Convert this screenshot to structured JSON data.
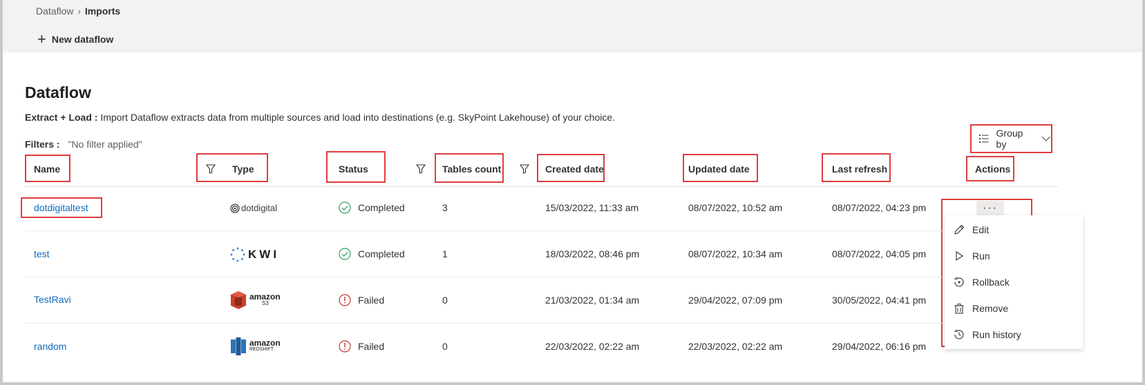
{
  "breadcrumb": {
    "root": "Dataflow",
    "current": "Imports"
  },
  "toolbar": {
    "new_label": "New dataflow"
  },
  "page": {
    "title": "Dataflow",
    "desc_bold": "Extract + Load :",
    "desc_text": "Import Dataflow extracts data from multiple sources and load into destinations (e.g. SkyPoint Lakehouse) of your choice.",
    "filters_label": "Filters :",
    "filters_value": "\"No filter applied\""
  },
  "groupby": {
    "label": "Group by"
  },
  "columns": {
    "name": "Name",
    "type": "Type",
    "status": "Status",
    "tables_count": "Tables count",
    "created_date": "Created date",
    "updated_date": "Updated date",
    "last_refresh": "Last refresh",
    "actions": "Actions"
  },
  "rows": [
    {
      "name": "dotdigitaltest",
      "type_logo": "dotdigital",
      "status": "Completed",
      "tables": "3",
      "created": "15/03/2022, 11:33 am",
      "updated": "08/07/2022, 10:52 am",
      "refresh": "08/07/2022, 04:23 pm"
    },
    {
      "name": "test",
      "type_logo": "KWI",
      "status": "Completed",
      "tables": "1",
      "created": "18/03/2022, 08:46 pm",
      "updated": "08/07/2022, 10:34 am",
      "refresh": "08/07/2022, 04:05 pm"
    },
    {
      "name": "TestRavi",
      "type_logo": "amazon",
      "type_sub": "S3",
      "status": "Failed",
      "tables": "0",
      "created": "21/03/2022, 01:34 am",
      "updated": "29/04/2022, 07:09 pm",
      "refresh": "30/05/2022, 04:41 pm"
    },
    {
      "name": "random",
      "type_logo": "amazon",
      "type_sub": "REDSHIFT",
      "status": "Failed",
      "tables": "0",
      "created": "22/03/2022, 02:22 am",
      "updated": "22/03/2022, 02:22 am",
      "refresh": "29/04/2022, 06:16 pm"
    }
  ],
  "actions_menu": {
    "more_label": "···",
    "items": [
      "Edit",
      "Run",
      "Rollback",
      "Remove",
      "Run history"
    ]
  },
  "colors": {
    "link": "#0f6cbd",
    "completed": "#2ca25f",
    "failed": "#c0392b",
    "highlight": "#e03c3c"
  }
}
